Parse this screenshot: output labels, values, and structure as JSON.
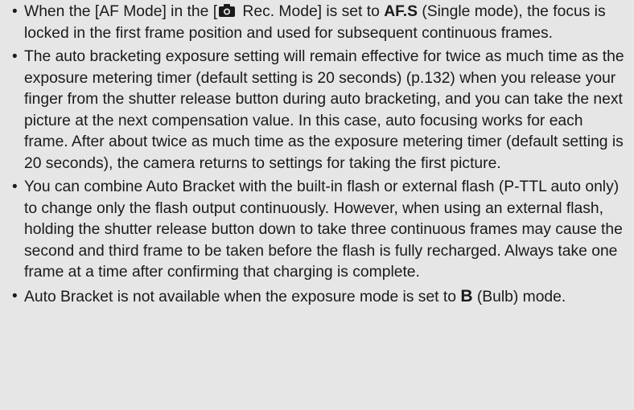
{
  "notes": {
    "bullet": "•",
    "note1": {
      "pre": "When the [AF Mode] in the [",
      "icon": "camera-icon",
      "mid": " Rec. Mode] is set to ",
      "mode": "AF.S",
      "post": " (Single mode), the focus is locked in the first frame position and used for subsequent continuous frames."
    },
    "note2": {
      "text": "The auto bracketing exposure setting will remain effective for twice as much time as the exposure metering timer (default setting is 20 seconds) (p.132) when you release your finger from the shutter release button during auto bracketing, and you can take the next picture at the next compensation value. In this case, auto focusing works for each frame. After about twice as much time as the exposure metering timer (default setting is 20 seconds), the camera returns to settings for taking the first picture."
    },
    "note3": {
      "text": "You can combine Auto Bracket with the built-in flash or external flash (P-TTL auto only) to change only the flash output continuously. However, when using an external flash, holding the shutter release button down to take three continuous frames may cause the second and third frame to be taken before the flash is fully recharged. Always take one frame at a time after confirming that charging is complete."
    },
    "note4": {
      "pre": "Auto Bracket is not available when the exposure mode is set to ",
      "mode": "B",
      "post": " (Bulb) mode."
    }
  }
}
